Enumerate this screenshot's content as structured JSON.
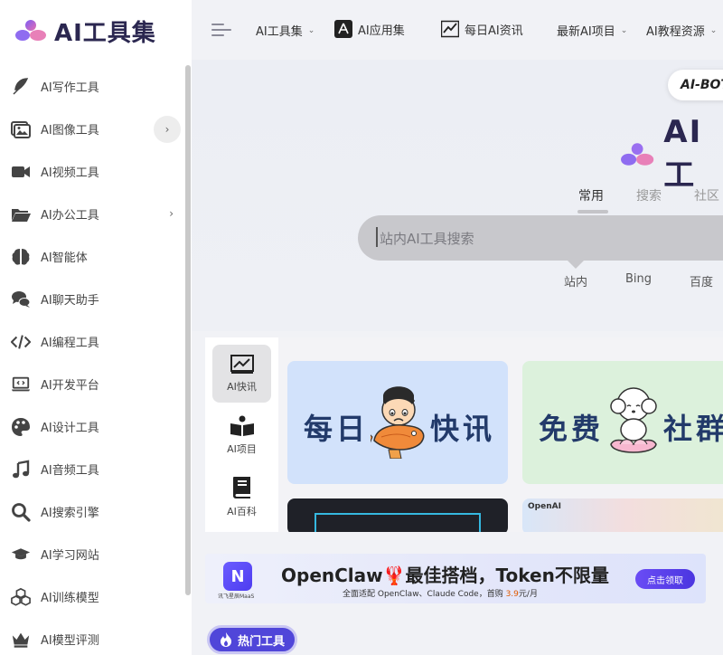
{
  "brand": {
    "name": "AI工具集",
    "accent": "#5046d9",
    "dark": "#2b2750"
  },
  "sidebar": {
    "items": [
      {
        "label": "AI写作工具",
        "icon": "feather-icon"
      },
      {
        "label": "AI图像工具",
        "icon": "image-icon",
        "expand": true,
        "circled": true
      },
      {
        "label": "AI视频工具",
        "icon": "video-icon"
      },
      {
        "label": "AI办公工具",
        "icon": "folder-icon",
        "expand": true
      },
      {
        "label": "AI智能体",
        "icon": "brain-icon"
      },
      {
        "label": "AI聊天助手",
        "icon": "chat-icon"
      },
      {
        "label": "AI编程工具",
        "icon": "code-icon"
      },
      {
        "label": "AI开发平台",
        "icon": "laptop-code-icon"
      },
      {
        "label": "AI设计工具",
        "icon": "palette-icon"
      },
      {
        "label": "AI音频工具",
        "icon": "music-icon"
      },
      {
        "label": "AI搜索引擎",
        "icon": "search-icon"
      },
      {
        "label": "AI学习网站",
        "icon": "graduation-cap-icon"
      },
      {
        "label": "AI训练模型",
        "icon": "cubes-icon"
      },
      {
        "label": "AI模型评测",
        "icon": "crown-icon"
      }
    ]
  },
  "topnav": {
    "items": [
      {
        "label": "AI工具集",
        "caret": true
      },
      {
        "label": "AI应用集",
        "icon": "app-store-icon"
      },
      {
        "label": "每日AI资讯",
        "icon": "chart-icon"
      },
      {
        "label": "最新AI项目",
        "caret": true
      },
      {
        "label": "AI教程资源",
        "caret": true
      }
    ]
  },
  "hero": {
    "badge": "AI-BOT",
    "logo_text": "AI工",
    "tabs": [
      "常用",
      "搜索",
      "社区"
    ],
    "search_placeholder": "站内AI工具搜索",
    "engines": [
      "站内",
      "Bing",
      "百度"
    ]
  },
  "panel": {
    "tabs": [
      {
        "label": "AI快讯",
        "icon": "trend-chart-icon",
        "active": true
      },
      {
        "label": "AI项目",
        "icon": "book-open-icon"
      },
      {
        "label": "AI百科",
        "icon": "book-icon"
      }
    ],
    "cards": {
      "news_left": "每日",
      "news_right": "快讯",
      "group_left": "免费",
      "group_right": "社群",
      "openai_label": "OpenAI"
    }
  },
  "banner": {
    "logo_letter": "N",
    "logo_caption": "讯飞星辰MaaS",
    "title": "OpenClaw🦞最佳搭档，Token不限量",
    "sub_prefix": "全面适配 OpenClaw、Claude Code，首购 ",
    "sub_price": "3.9",
    "sub_suffix": "元/月",
    "button": "点击领取"
  },
  "hot": {
    "label": "热门工具"
  }
}
